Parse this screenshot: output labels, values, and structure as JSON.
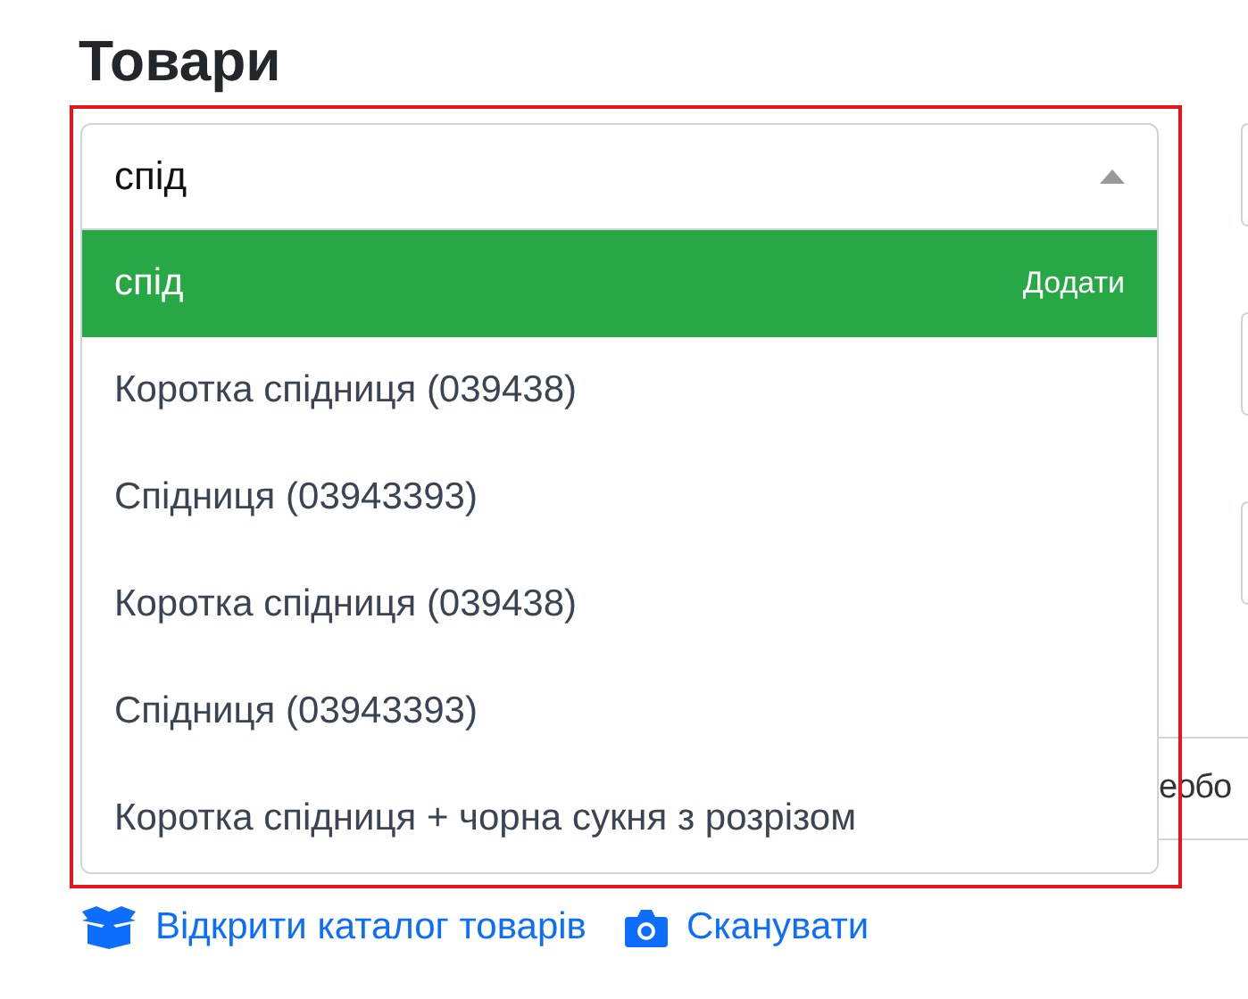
{
  "heading": "Товари",
  "combobox": {
    "value": "спід",
    "expanded": true,
    "highlighted": true,
    "options": [
      {
        "kind": "create",
        "label": "спід",
        "action": "Додати",
        "selected": true
      },
      {
        "kind": "product",
        "label": "Коротка спідниця (039438)",
        "selected": false
      },
      {
        "kind": "product",
        "label": "Спідниця (03943393)",
        "selected": false
      },
      {
        "kind": "product",
        "label": "Коротка спідниця (039438)",
        "selected": false
      },
      {
        "kind": "product",
        "label": "Спідниця (03943393)",
        "selected": false
      },
      {
        "kind": "product",
        "label": "Коротка спідниця + чорна сукня з розрізом",
        "selected": false
      }
    ]
  },
  "links": [
    {
      "label": "Відкрити каталог товарів"
    },
    {
      "label": "Сканувати"
    }
  ],
  "side_text": "еобо"
}
